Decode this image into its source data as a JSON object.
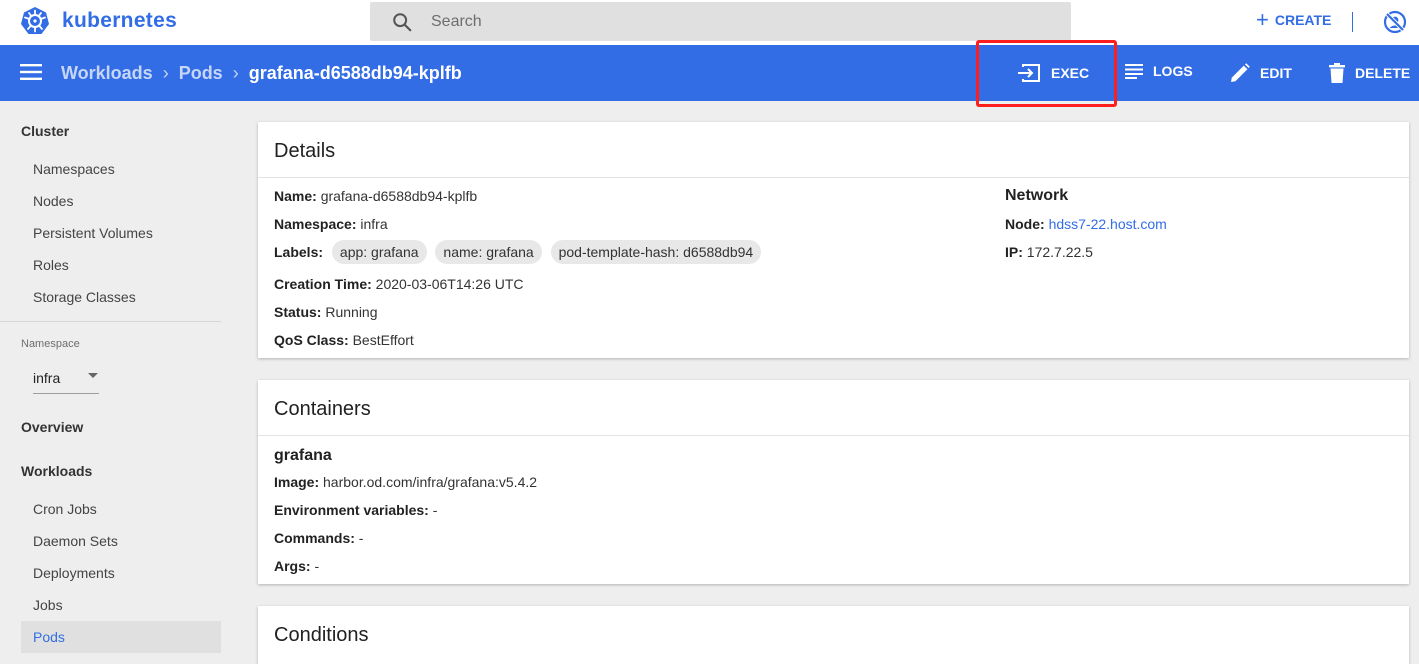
{
  "header": {
    "brand": "kubernetes",
    "search_placeholder": "Search",
    "create_label": "CREATE",
    "create_icon": "plus-icon",
    "account_icon": "user-off-icon"
  },
  "actionbar": {
    "breadcrumb": [
      "Workloads",
      "Pods"
    ],
    "current": "grafana-d6588db94-kplfb",
    "actions": {
      "exec": "EXEC",
      "logs": "LOGS",
      "edit": "EDIT",
      "delete": "DELETE"
    }
  },
  "sidebar": {
    "cluster_heading": "Cluster",
    "cluster_items": [
      "Namespaces",
      "Nodes",
      "Persistent Volumes",
      "Roles",
      "Storage Classes"
    ],
    "namespace_label": "Namespace",
    "namespace_value": "infra",
    "overview": "Overview",
    "workloads_heading": "Workloads",
    "workload_items": [
      "Cron Jobs",
      "Daemon Sets",
      "Deployments",
      "Jobs",
      "Pods"
    ],
    "active_item": "Pods"
  },
  "details": {
    "title": "Details",
    "name_label": "Name:",
    "name": "grafana-d6588db94-kplfb",
    "namespace_label": "Namespace:",
    "namespace": "infra",
    "labels_label": "Labels:",
    "labels": [
      "app: grafana",
      "name: grafana",
      "pod-template-hash: d6588db94"
    ],
    "creation_label": "Creation Time:",
    "creation_time": "2020-03-06T14:26 UTC",
    "status_label": "Status:",
    "status": "Running",
    "qos_label": "QoS Class:",
    "qos": "BestEffort",
    "network_heading": "Network",
    "node_label": "Node:",
    "node": "hdss7-22.host.com",
    "ip_label": "IP:",
    "ip": "172.7.22.5"
  },
  "containers": {
    "title": "Containers",
    "name": "grafana",
    "image_label": "Image:",
    "image": "harbor.od.com/infra/grafana:v5.4.2",
    "env_label": "Environment variables:",
    "env": "-",
    "commands_label": "Commands:",
    "commands": "-",
    "args_label": "Args:",
    "args": "-"
  },
  "conditions": {
    "title": "Conditions"
  },
  "colors": {
    "primary": "#326de6",
    "highlight_box": "#ff1e1e"
  }
}
